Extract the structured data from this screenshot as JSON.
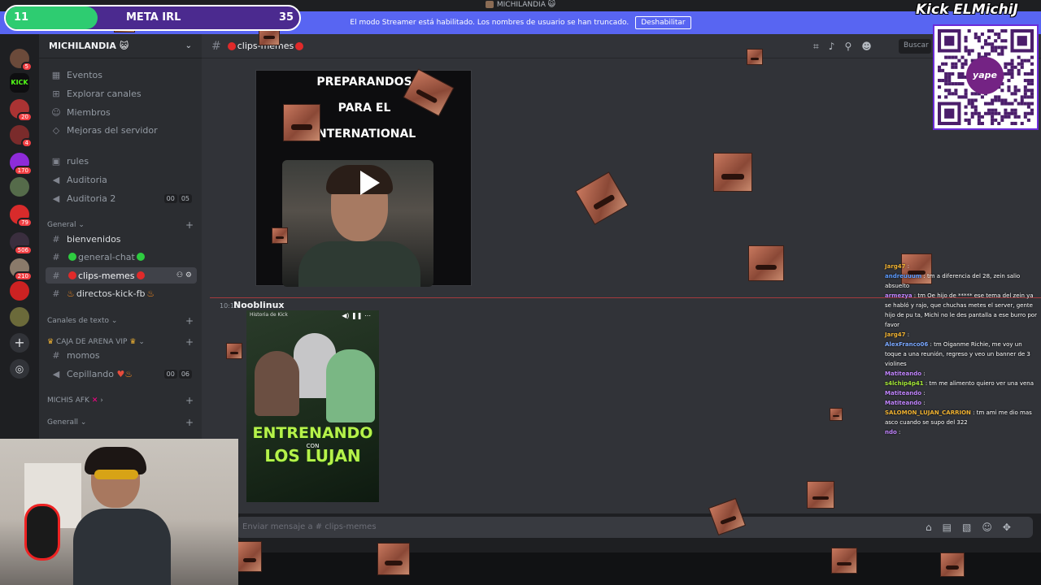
{
  "window": {
    "title": "MICHILANDIA 😺"
  },
  "banner": {
    "text": "El modo Streamer está habilitado. Los nombres de usuario se han truncado.",
    "button": "Deshabilitar"
  },
  "server": {
    "name": "MICHILANDIA 😺"
  },
  "rail_badges": [
    "5",
    "20",
    "4",
    "170",
    "79",
    "506",
    "210"
  ],
  "sidebar": {
    "top_items": [
      "Eventos",
      "Explorar canales",
      "Miembros",
      "Mejoras del servidor"
    ],
    "channels_a": [
      "rules",
      "Auditoria",
      "Auditoria 2"
    ],
    "voice_count_a": [
      "00",
      "05"
    ],
    "cat_general": "General",
    "channels_general": [
      "bienvenidos",
      "general-chat",
      "clips-memes",
      "directos-kick-fb"
    ],
    "cat_text": "Canales de texto",
    "cat_vip": "CAJA DE ARENA VIP",
    "channels_vip": [
      "momos",
      "Cepillando"
    ],
    "voice_count_b": [
      "00",
      "06"
    ],
    "cat_afk": "MICHIS AFK",
    "cat_generall": "Generall"
  },
  "channel": {
    "name": "clips-memes"
  },
  "header": {
    "search_placeholder": "Buscar"
  },
  "post": {
    "video_title_lines": [
      "PREPARANDOS",
      "PARA EL",
      "INTERNATIONAL"
    ],
    "time": "10:15",
    "author": "Nooblinux",
    "thumb_top": "Historia de Kick",
    "thumb_title1": "ENTRENANDO",
    "thumb_title_small": "CON",
    "thumb_title2": "LOS LUJAN"
  },
  "composer": {
    "placeholder": "Enviar mensaje a # clips-memes"
  },
  "goal": {
    "current": "11",
    "label": "META IRL",
    "target": "35",
    "progress": 0.314
  },
  "brand": "Kick ELMichiJ",
  "qr_label": "yape",
  "overlay_chat": [
    {
      "user": "Jarg47",
      "text": ":"
    },
    {
      "user": "andreuuum",
      "text": ": tm a diferencia del 28, zein salio absuelto"
    },
    {
      "user": "armezya",
      "text": ": tm Oe hijo de ***** ese tema del zein ya se habló y rajo, que chuchas metes el server, gente hijo de pu ta, Michi no le des pantalla a ese burro por favor"
    },
    {
      "user": "Jarg47",
      "text": ":"
    },
    {
      "user": "AlexFranco06",
      "text": ": tm Oiganme Richie, me voy un toque a una reunión, regreso y veo un banner de 3 violines"
    },
    {
      "user": "Matiteando",
      "text": ":"
    },
    {
      "user": "s4lchip4p41",
      "text": ": tm me alimento quiero ver una vena"
    },
    {
      "user": "Matiteando",
      "text": ":"
    },
    {
      "user": "Matiteando",
      "text": ":"
    },
    {
      "user": "SALOMON_LUJAN_CARRION",
      "text": ": tm ami me dio mas asco cuando se supo del 322"
    },
    {
      "user": "ndo",
      "text": ":"
    }
  ],
  "colors": {
    "blurple": "#5865f2",
    "goal_fill": "#2ecc71",
    "goal_bg": "#4b2a8f",
    "kick_green": "#53fc18",
    "unread_red": "#f23f43"
  },
  "icons": [
    "threads-icon",
    "bell-icon",
    "pin-icon",
    "members-icon",
    "gift-icon",
    "gif-icon",
    "sticker-icon",
    "emoji-icon",
    "gamepad-icon",
    "play-icon"
  ]
}
